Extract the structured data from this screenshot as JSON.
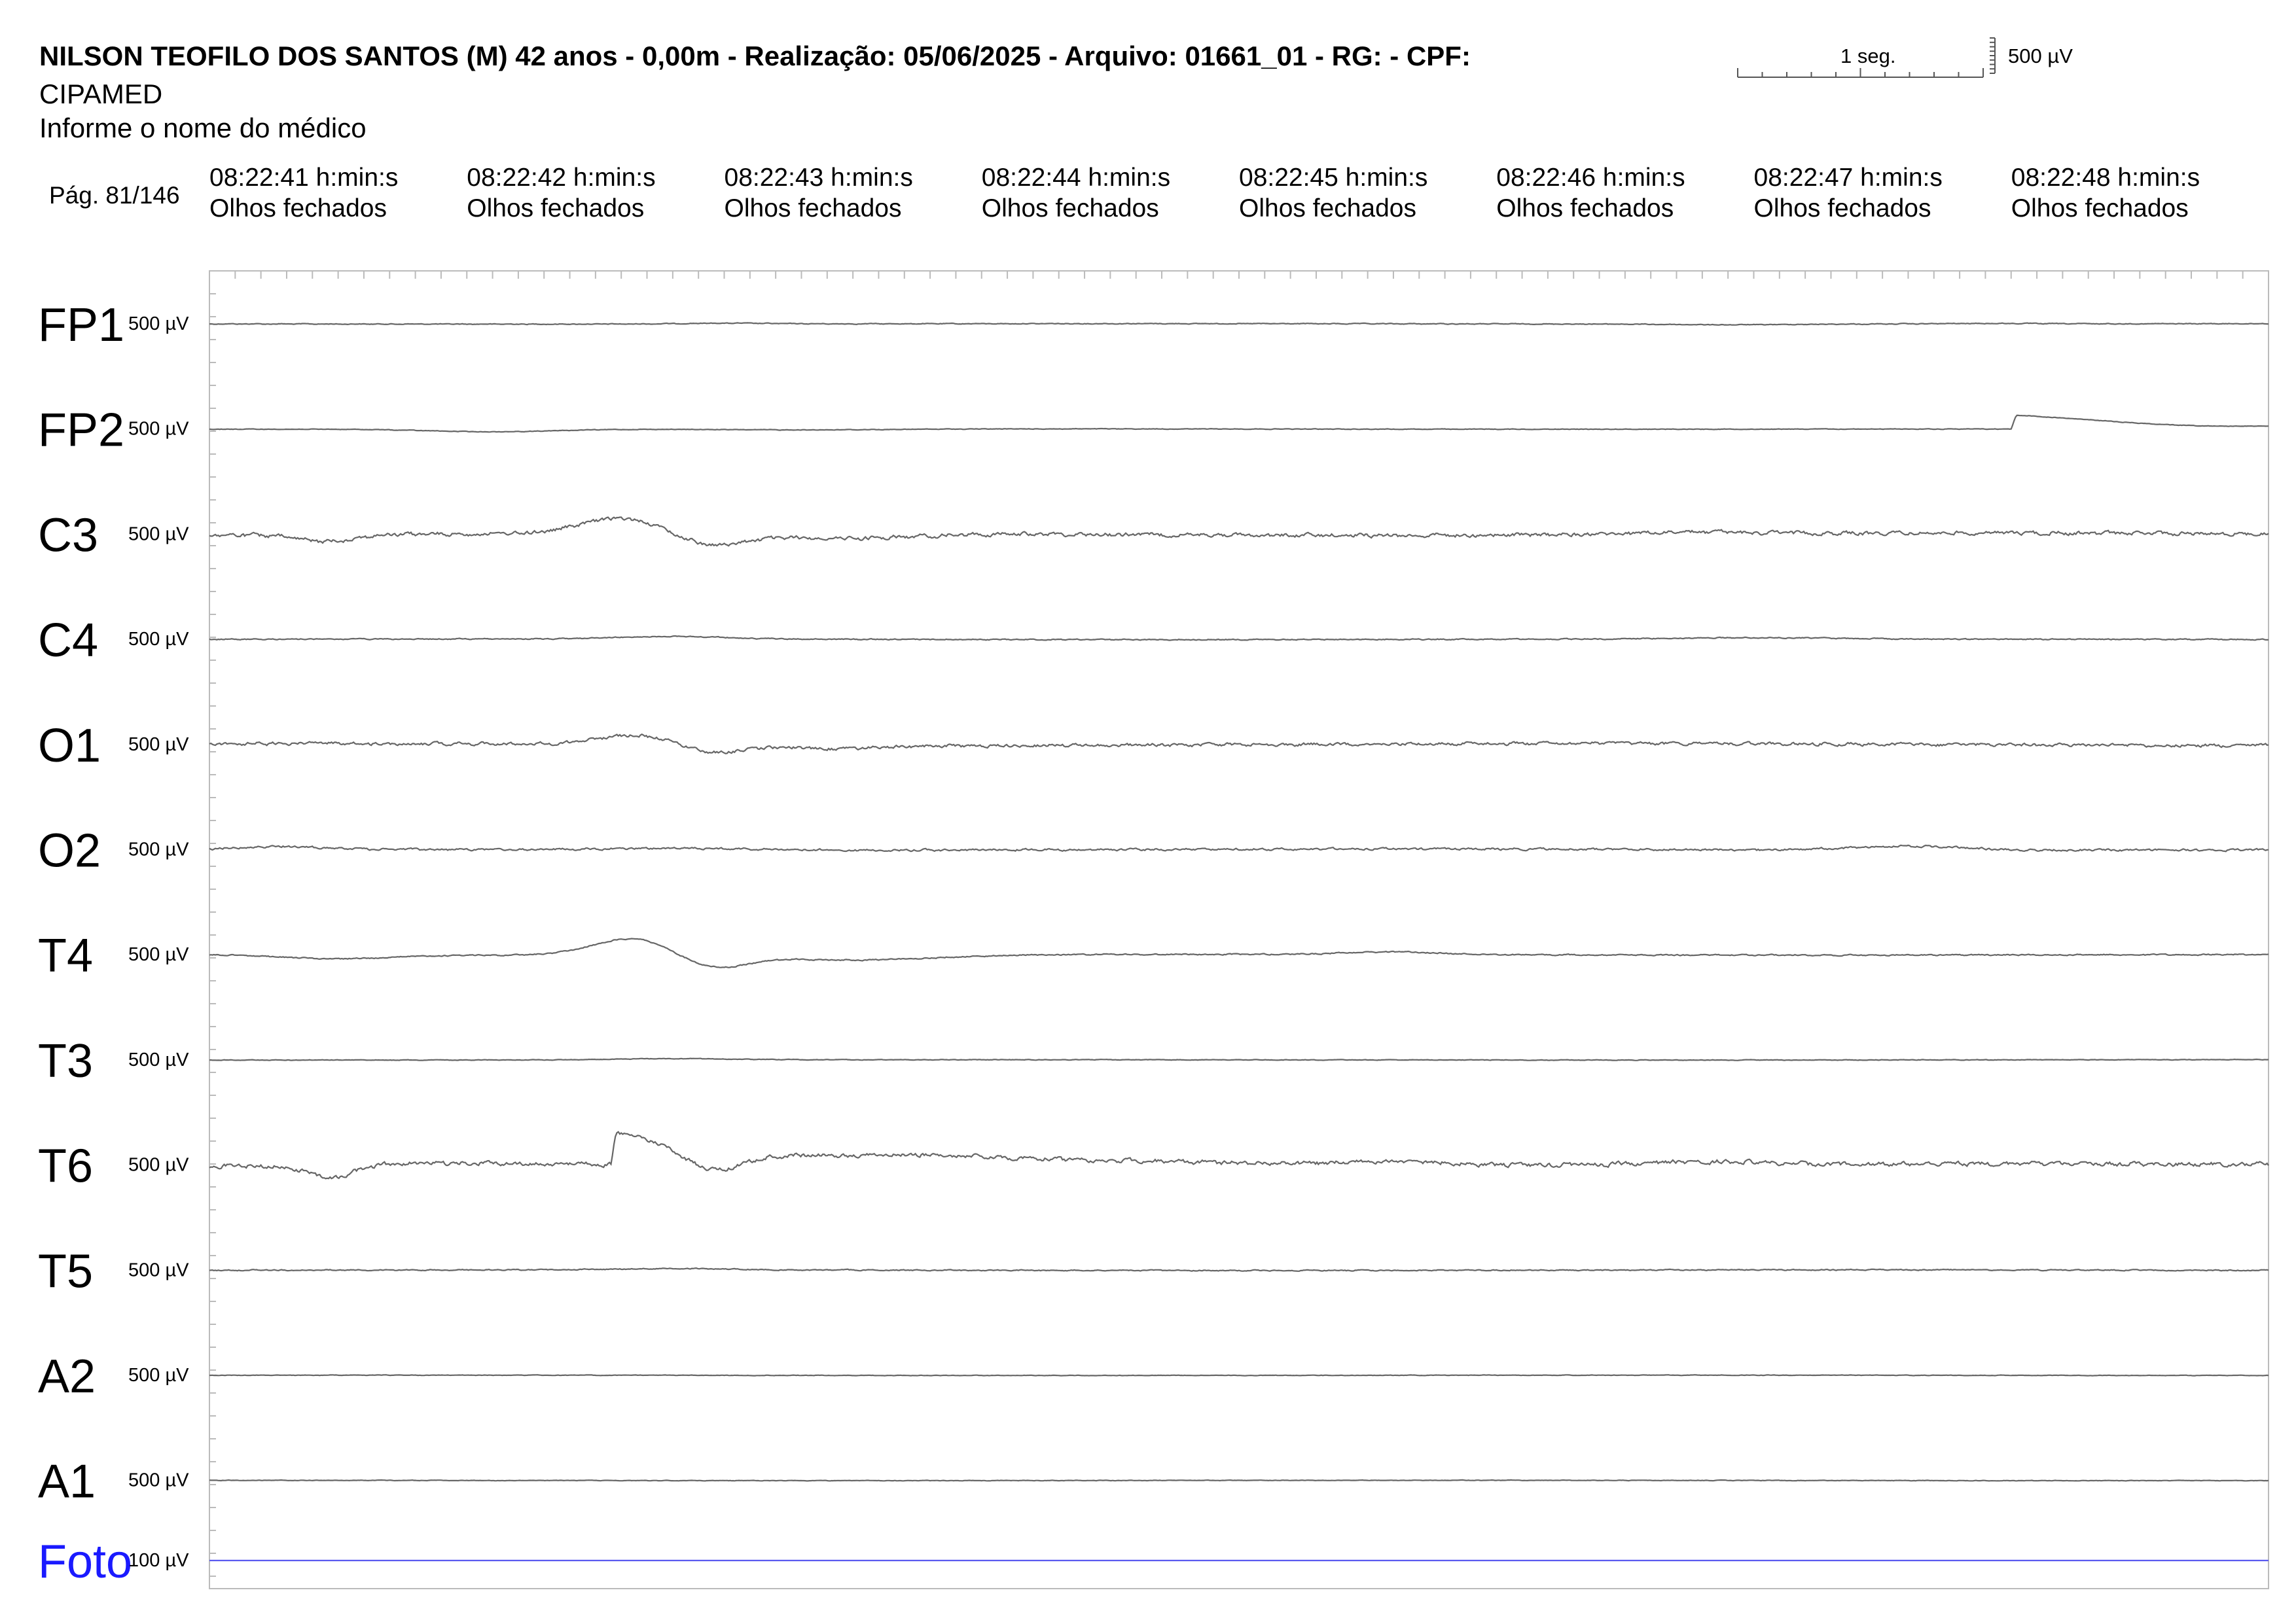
{
  "header": {
    "title": "NILSON TEOFILO DOS SANTOS (M) 42 anos - 0,00m - Realização: 05/06/2025 - Arquivo: 01661_01 - RG:  - CPF:",
    "clinic": "CIPAMED",
    "doctor": "Informe o nome do médico",
    "page": "Pág. 81/146"
  },
  "scale_bar": {
    "time_label": "1 seg.",
    "amplitude_label": "500 µV"
  },
  "timestamps": [
    {
      "time": "08:22:41 h:min:s",
      "state": "Olhos fechados"
    },
    {
      "time": "08:22:42 h:min:s",
      "state": "Olhos fechados"
    },
    {
      "time": "08:22:43 h:min:s",
      "state": "Olhos fechados"
    },
    {
      "time": "08:22:44 h:min:s",
      "state": "Olhos fechados"
    },
    {
      "time": "08:22:45 h:min:s",
      "state": "Olhos fechados"
    },
    {
      "time": "08:22:46 h:min:s",
      "state": "Olhos fechados"
    },
    {
      "time": "08:22:47 h:min:s",
      "state": "Olhos fechados"
    },
    {
      "time": "08:22:48 h:min:s",
      "state": "Olhos fechados"
    }
  ],
  "chart_data": {
    "type": "line",
    "x_unit": "s",
    "x_range": [
      0,
      8
    ],
    "grid": false,
    "colors": {
      "trace": "#666666",
      "photic": "#5a5af0",
      "photic_label": "#1a1aff",
      "frame": "#bbbbbb"
    },
    "series": [
      {
        "name": "FP1",
        "scale": "500 µV",
        "noise": 0.45,
        "events": [
          {
            "t": 2.0,
            "a": -1.2,
            "w": 0.25
          },
          {
            "t": 5.9,
            "a": 1.0,
            "w": 0.3
          },
          {
            "t": 6.9,
            "a": -0.8,
            "w": 0.3
          }
        ]
      },
      {
        "name": "FP2",
        "scale": "500 µV",
        "noise": 0.35,
        "events": [
          {
            "t": 1.1,
            "a": 4.0,
            "w": 0.35
          },
          {
            "t": 2.3,
            "a": 1.5,
            "w": 0.5
          },
          {
            "t": 7.0,
            "a": -22,
            "w": 0.12,
            "shape": "step",
            "decay": 0.9
          },
          {
            "t": 7.7,
            "a": 5,
            "w": 0.4
          }
        ]
      },
      {
        "name": "C3",
        "scale": "500 µV",
        "noise": 2.2,
        "events": [
          {
            "t": 0.45,
            "a": 10,
            "w": 0.15
          },
          {
            "t": 1.6,
            "a": -23,
            "w": 0.22
          },
          {
            "t": 1.95,
            "a": 18,
            "w": 0.18
          },
          {
            "t": 2.45,
            "a": 8,
            "w": 0.4
          },
          {
            "t": 5.75,
            "a": -3,
            "w": 0.3
          }
        ]
      },
      {
        "name": "C4",
        "scale": "500 µV",
        "noise": 0.6,
        "events": [
          {
            "t": 1.8,
            "a": -4,
            "w": 0.3
          },
          {
            "t": 6.0,
            "a": -2,
            "w": 0.4
          }
        ]
      },
      {
        "name": "O1",
        "scale": "500 µV",
        "noise": 1.8,
        "events": [
          {
            "t": 1.65,
            "a": -14,
            "w": 0.2
          },
          {
            "t": 1.95,
            "a": 12,
            "w": 0.15
          },
          {
            "t": 2.4,
            "a": 5,
            "w": 0.35
          }
        ]
      },
      {
        "name": "O2",
        "scale": "500 µV",
        "noise": 1.2,
        "events": [
          {
            "t": 0.3,
            "a": -4,
            "w": 0.2
          },
          {
            "t": 1.8,
            "a": -3,
            "w": 0.4
          },
          {
            "t": 6.6,
            "a": -6,
            "w": 0.3
          }
        ]
      },
      {
        "name": "T4",
        "scale": "500 µV",
        "noise": 0.7,
        "events": [
          {
            "t": 0.5,
            "a": 6,
            "w": 0.3
          },
          {
            "t": 1.65,
            "a": -26,
            "w": 0.22
          },
          {
            "t": 1.95,
            "a": 20,
            "w": 0.18
          },
          {
            "t": 2.5,
            "a": 8,
            "w": 0.45
          },
          {
            "t": 4.6,
            "a": -4,
            "w": 0.25
          }
        ]
      },
      {
        "name": "T3",
        "scale": "500 µV",
        "noise": 0.35,
        "events": [
          {
            "t": 1.8,
            "a": -2,
            "w": 0.3
          }
        ]
      },
      {
        "name": "T6",
        "scale": "500 µV",
        "noise": 2.4,
        "events": [
          {
            "t": 0.47,
            "a": 19,
            "w": 0.12
          },
          {
            "t": 0.9,
            "a": -3,
            "w": 0.4
          },
          {
            "t": 1.56,
            "a": -50,
            "w": 0.18,
            "shape": "step",
            "decay": 1.0
          },
          {
            "t": 1.95,
            "a": 38,
            "w": 0.18
          },
          {
            "t": 2.3,
            "a": 10,
            "w": 0.35
          },
          {
            "t": 4.6,
            "a": -6,
            "w": 0.25
          },
          {
            "t": 5.8,
            "a": -5,
            "w": 0.3
          }
        ]
      },
      {
        "name": "T5",
        "scale": "500 µV",
        "noise": 0.6,
        "events": [
          {
            "t": 1.8,
            "a": -2,
            "w": 0.3
          }
        ]
      },
      {
        "name": "A2",
        "scale": "500 µV",
        "noise": 0.3,
        "events": []
      },
      {
        "name": "A1",
        "scale": "500 µV",
        "noise": 0.3,
        "events": []
      },
      {
        "name": "Foto",
        "scale": "100 µV",
        "noise": 0,
        "events": [],
        "photic": true
      }
    ]
  }
}
